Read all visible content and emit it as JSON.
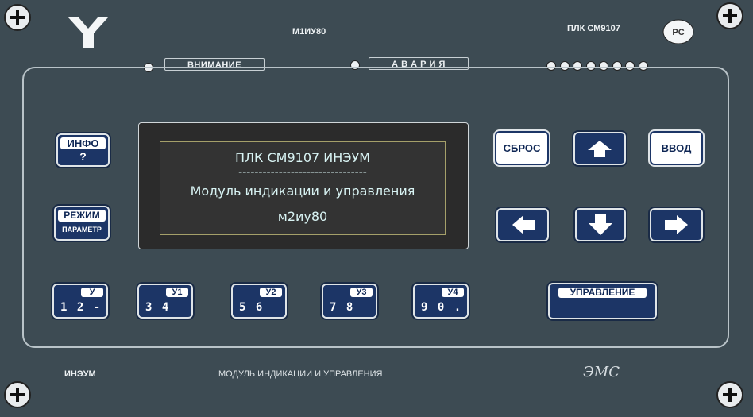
{
  "header": {
    "model": "М1ИУ80",
    "plc_name": "ПЛК СМ9107",
    "logo_icon": "y-fork-logo-icon",
    "cert_icon": "rst-certification-icon"
  },
  "indicators": {
    "attention_label": "ВНИМАНИЕ",
    "alarm_label": "А В А Р И Я",
    "led_count": 8
  },
  "display": {
    "line1": "ПЛК СМ9107 ИНЭУМ",
    "line2": "--------------------------------",
    "line3": "Модуль индикации и управления",
    "line4": "м2иу80"
  },
  "left_buttons": {
    "info_label": "ИНФО",
    "info_sub": "?",
    "mode_label": "РЕЖИМ",
    "mode_sub": "ПАРАМЕТР"
  },
  "nav": {
    "reset_label": "СБРОС",
    "enter_label": "ВВОД"
  },
  "keys": [
    {
      "chip": "У",
      "digits": "1 2 -"
    },
    {
      "chip": "У1",
      "digits": "3 4"
    },
    {
      "chip": "У2",
      "digits": "5 6"
    },
    {
      "chip": "У3",
      "digits": "7 8"
    },
    {
      "chip": "У4",
      "digits": "9 0 ."
    }
  ],
  "control_label": "УПРАВЛЕНИЕ",
  "footer": {
    "maker": "ИНЭУМ",
    "title": "МОДУЛЬ ИНДИКАЦИИ И УПРАВЛЕНИЯ",
    "brand": "ЭМС"
  },
  "colors": {
    "panel": "#3d4b53",
    "button_blue": "#1c3566",
    "lcd_text": "#d8f3f3"
  }
}
